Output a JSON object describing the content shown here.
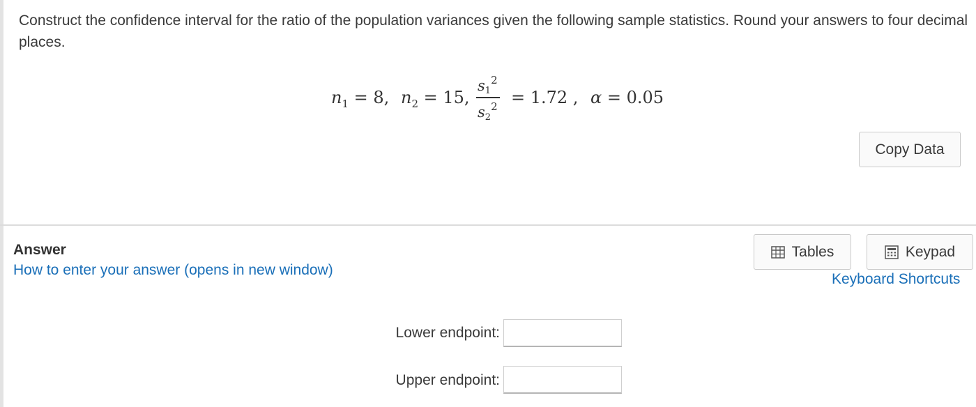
{
  "question": {
    "text": "Construct the confidence interval for the ratio of the population variances given the following sample statistics. Round your answers to four decimal places.",
    "formula": {
      "n1_var": "n",
      "n1_sub": "1",
      "n1_value": " = 8, ",
      "n2_var": "n",
      "n2_sub": "2",
      "n2_value": " = 15, ",
      "ratio_num_var": "s",
      "ratio_num_sub": "1",
      "ratio_num_sup": "2",
      "ratio_den_var": "s",
      "ratio_den_sub": "2",
      "ratio_den_sup": "2",
      "ratio_value": "= 1.72 , ",
      "alpha_var": "α",
      "alpha_value": " = 0.05"
    },
    "copy_button": "Copy Data"
  },
  "answer": {
    "title": "Answer",
    "help_link": "How to enter your answer (opens in new window)",
    "tables_button": "Tables",
    "keypad_button": "Keypad",
    "shortcuts_link": "Keyboard Shortcuts",
    "fields": {
      "lower_label": "Lower endpoint:",
      "lower_value": "",
      "upper_label": "Upper endpoint:",
      "upper_value": ""
    }
  },
  "icons": {
    "tables": "table-grid-icon",
    "keypad": "calculator-keypad-icon"
  },
  "colors": {
    "link": "#1a6fb8",
    "text": "#3a3a3a",
    "panel_border": "#e3e3e3",
    "button_bg": "#fafafa"
  }
}
